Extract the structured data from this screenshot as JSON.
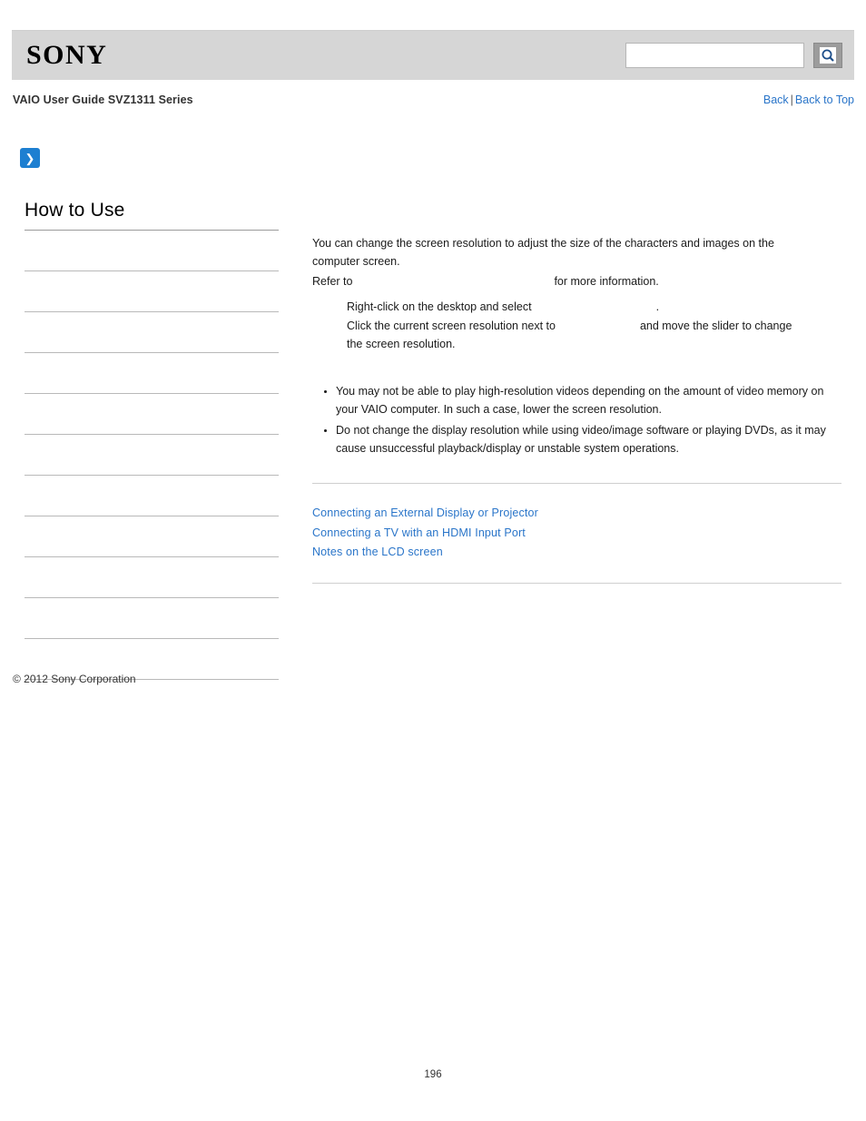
{
  "header": {
    "brand": "SONY",
    "search": {
      "value": "",
      "placeholder": "",
      "icon": "search-icon"
    }
  },
  "subheader": {
    "guide_title": "VAIO User Guide SVZ1311 Series",
    "nav": {
      "back": "Back",
      "separator": "|",
      "back_to_top": "Back to Top"
    }
  },
  "sidebar": {
    "title": "How to Use",
    "items": [
      {
        "label": ""
      },
      {
        "label": ""
      },
      {
        "label": ""
      },
      {
        "label": ""
      },
      {
        "label": ""
      },
      {
        "label": ""
      },
      {
        "label": ""
      },
      {
        "label": ""
      },
      {
        "label": ""
      },
      {
        "label": ""
      },
      {
        "label": ""
      }
    ]
  },
  "main": {
    "intro_line1": "You can change the screen resolution to adjust the size of the characters and images on the",
    "intro_line2": "computer screen.",
    "refer_prefix": "Refer to",
    "refer_link": "",
    "refer_suffix": "for more information.",
    "steps": [
      {
        "text_before": "Right-click on the desktop and select",
        "link": "",
        "text_after": "."
      },
      {
        "text_before": "Click the current screen resolution next to",
        "link": "",
        "text_after": "and move the slider to change",
        "text_line2": "the screen resolution."
      }
    ],
    "notes": [
      "You may not be able to play high-resolution videos depending on the amount of video memory on your VAIO computer. In such a case, lower the screen resolution.",
      "Do not change the display resolution while using video/image software or playing DVDs, as it may cause unsuccessful playback/display or unstable system operations."
    ],
    "related_links": [
      "Connecting an External Display or Projector",
      "Connecting a TV with an HDMI Input Port",
      "Notes on the LCD screen"
    ]
  },
  "footer": {
    "copyright": "© 2012 Sony Corporation",
    "page_number": "196"
  },
  "colors": {
    "link": "#2a75c9",
    "header_bg": "#d6d6d6",
    "accent": "#1d7fd1"
  }
}
